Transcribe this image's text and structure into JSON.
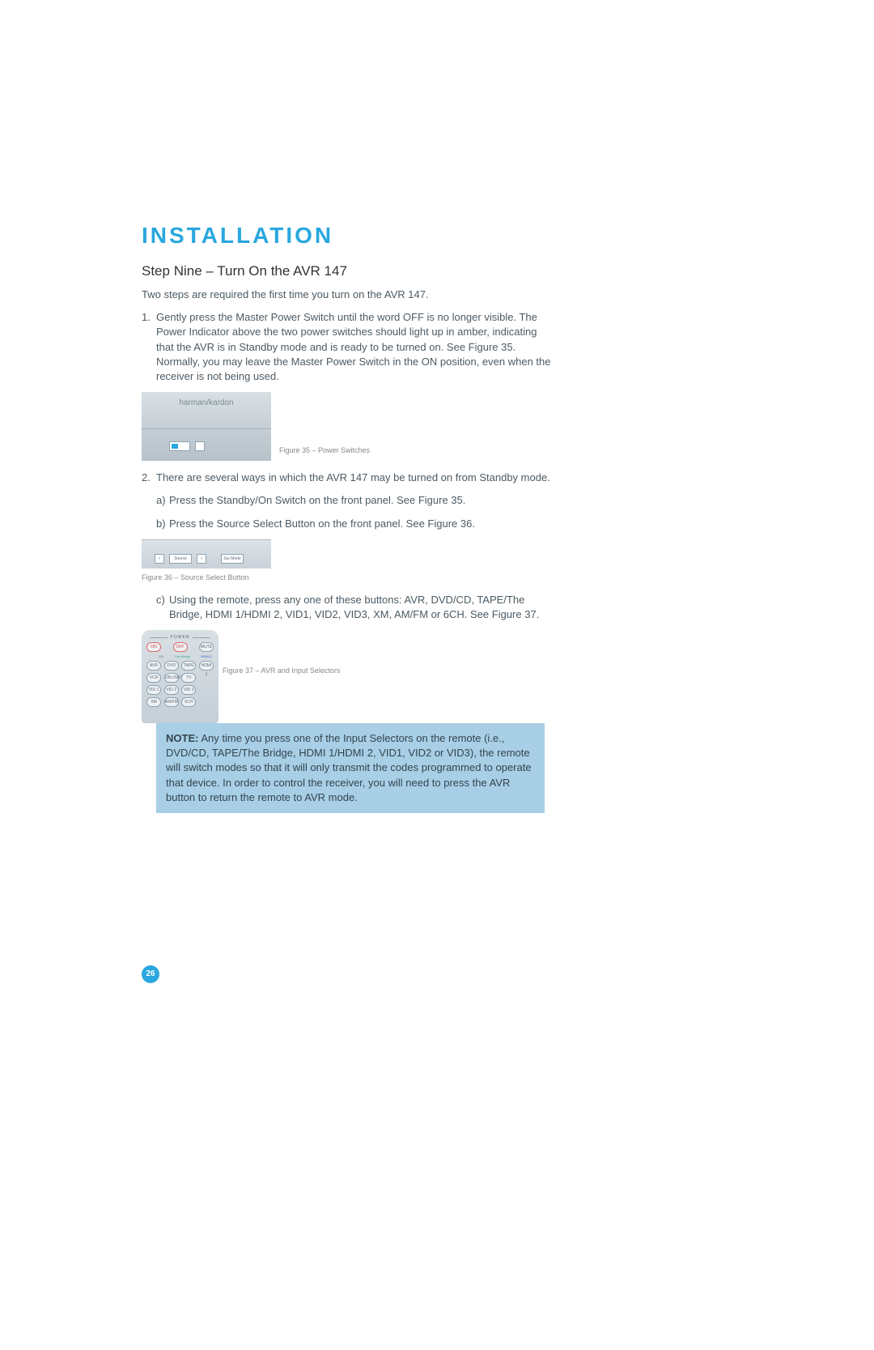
{
  "section_title": "INSTALLATION",
  "step_title": "Step Nine – Turn On the AVR 147",
  "intro": "Two steps are required the first time you turn on the AVR 147.",
  "item1_num": "1.",
  "item1_text": "Gently press the Master Power Switch until the word OFF is no longer visible. The Power Indicator above the two power switches should light up in amber, indicating that the AVR is in Standby mode and is ready to be turned on. See Figure 35. Normally, you may leave the Master Power Switch in the ON position, even when the receiver is not being used.",
  "fig35_brand": "harman/kardon",
  "fig35_caption": "Figure 35 – Power Switches",
  "item2_num": "2.",
  "item2_text": "There are several ways in which the AVR 147 may be turned on from Standby mode.",
  "item2a_letter": "a)",
  "item2a_text": "Press the Standby/On Switch on the front panel. See Figure 35.",
  "item2b_letter": "b)",
  "item2b_text": "Press the Source Select Button on the front panel. See Figure 36.",
  "fig36_caption": "Figure 36 – Source Select Button",
  "fig36_source": "Source",
  "fig36_surr": "Sur.Mode",
  "item2c_letter": "c)",
  "item2c_text": "Using the remote, press any one of these buttons: AVR, DVD/CD, TAPE/The Bridge, HDMI 1/HDMI 2, VID1, VID2, VID3, XM, AM/FM or 6CH. See Figure 37.",
  "fig37_caption": "Figure 37 – AVR and Input Selectors",
  "remote": {
    "power": "POWER",
    "on": "ON",
    "off": "OFF",
    "mute": "MUTE",
    "cd": "CD",
    "bridge": "The Bridge",
    "hdmi2": "HDMI 2",
    "avr": "AVR",
    "dvd": "DVD",
    "tape": "TAPE",
    "hdmi1": "HDMI 1",
    "vcr": "VCR",
    "cblsat": "CBL/SAT",
    "tv": "TV",
    "vid1": "VID 1",
    "vid2": "VID 2",
    "vid3": "VID 3",
    "xm": "XM",
    "amfm": "AM/FM",
    "sixch": "6CH"
  },
  "note_strong": "NOTE:",
  "note_text": " Any time you press one of the Input Selectors on the remote (i.e., DVD/CD, TAPE/The Bridge, HDMI 1/HDMI 2, VID1, VID2 or VID3), the remote will switch modes so that it will only transmit the codes programmed to operate that device. In order to control the receiver, you will need to press the AVR button to return the remote to AVR mode.",
  "page_number": "26"
}
